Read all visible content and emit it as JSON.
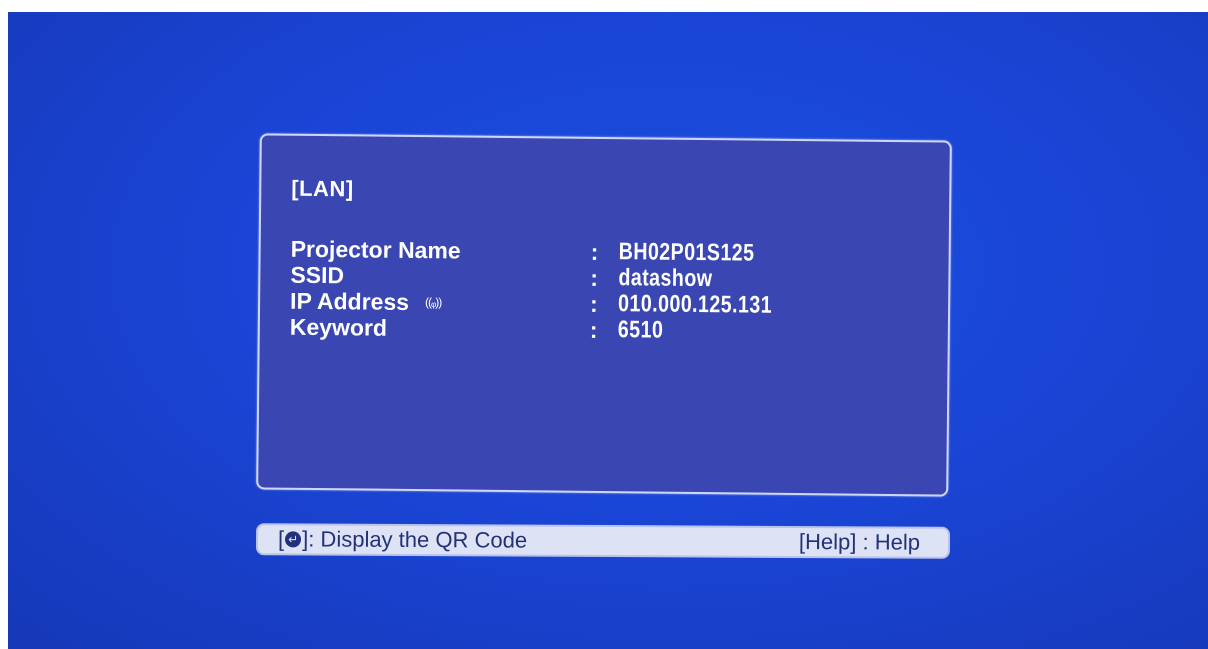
{
  "panel": {
    "title": "[LAN]",
    "rows": [
      {
        "label": "Projector Name",
        "colon": ":",
        "value": "BH02P01S125"
      },
      {
        "label": "SSID",
        "colon": ":",
        "value": "datashow"
      },
      {
        "label": "IP Address",
        "colon": ":",
        "value": "010.000.125.131",
        "icon": "wireless-signal-icon",
        "icon_glyph": "((ᵩ))"
      },
      {
        "label": "Keyword",
        "colon": ":",
        "value": "6510"
      }
    ]
  },
  "hint_bar": {
    "left_open": "[",
    "enter_icon": "enter-key-icon",
    "enter_glyph": "↵",
    "left_close": "]: Display the QR Code",
    "right": "[Help] : Help"
  },
  "colors": {
    "background": "#1a45d6",
    "panel": "#3a46b2",
    "hint_bar": "#dde3f4",
    "text": "#ffffff"
  }
}
